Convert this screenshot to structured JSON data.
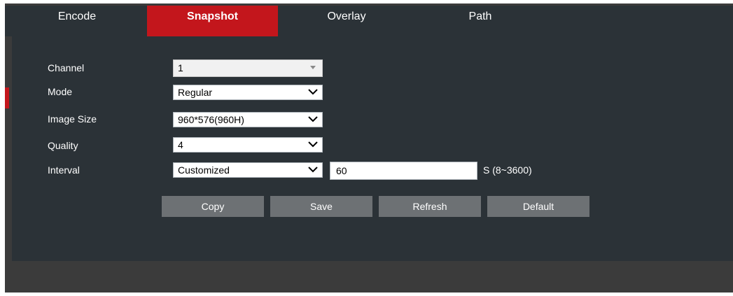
{
  "tabs": [
    {
      "label": "Encode",
      "active": false
    },
    {
      "label": "Snapshot",
      "active": true
    },
    {
      "label": "Overlay",
      "active": false
    },
    {
      "label": "Path",
      "active": false
    }
  ],
  "form": {
    "channel": {
      "label": "Channel",
      "value": "1"
    },
    "mode": {
      "label": "Mode",
      "value": "Regular"
    },
    "image_size": {
      "label": "Image Size",
      "value": "960*576(960H)"
    },
    "quality": {
      "label": "Quality",
      "value": "4"
    },
    "interval": {
      "label": "Interval",
      "value": "Customized",
      "seconds": "60",
      "unit": "S (8~3600)"
    }
  },
  "buttons": {
    "copy": "Copy",
    "save": "Save",
    "refresh": "Refresh",
    "default": "Default"
  },
  "colors": {
    "accent": "#c3161c",
    "panel_bg": "#2b3237",
    "button_bg": "#6d7174"
  },
  "icons": {
    "dropdown": "chevron-down-icon",
    "disabled_dropdown": "triangle-down-icon"
  }
}
